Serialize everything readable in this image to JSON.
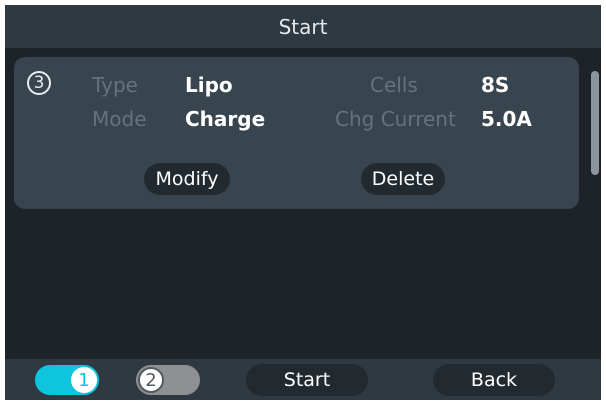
{
  "header": {
    "title": "Start"
  },
  "task_card": {
    "slot_number": "3",
    "type_label": "Type",
    "type_value": "Lipo",
    "mode_label": "Mode",
    "mode_value": "Charge",
    "cells_label": "Cells",
    "cells_value": "8S",
    "current_label": "Chg Current",
    "current_value": "5.0A",
    "modify_label": "Modify",
    "delete_label": "Delete"
  },
  "footer": {
    "toggle1_label": "1",
    "toggle1_on": true,
    "toggle2_label": "2",
    "toggle2_on": false,
    "start_label": "Start",
    "back_label": "Back"
  },
  "colors": {
    "screen_bg": "#1d2328",
    "bar_bg": "#2f3941",
    "card_bg": "#38454f",
    "button_bg": "#222a30",
    "toggle_on": "#0fc4dd",
    "toggle_off": "#8e9094",
    "label_text": "#66727c"
  }
}
